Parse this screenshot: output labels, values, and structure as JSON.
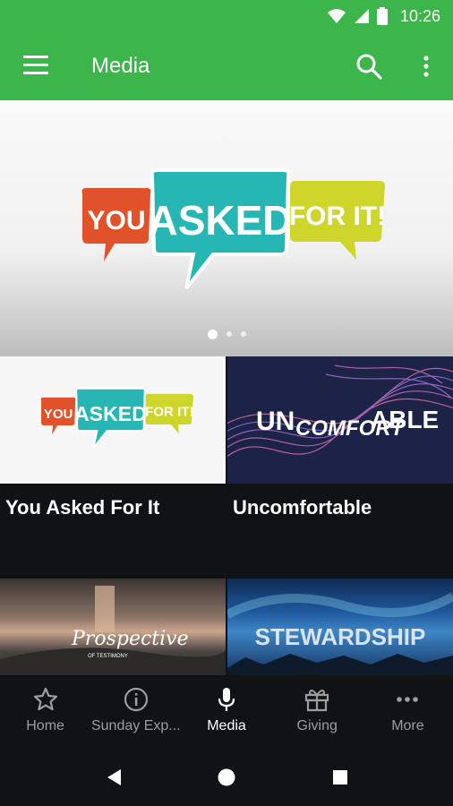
{
  "status_bar": {
    "time": "10:26"
  },
  "app_bar": {
    "title": "Media"
  },
  "hero": {
    "art_words": [
      "YOU",
      "ASKED",
      "FOR IT!"
    ],
    "colors": {
      "you": "#e2522a",
      "asked": "#26b7b5",
      "forit": "#cfd62b"
    },
    "slides": 3,
    "active_slide": 1
  },
  "cards": [
    {
      "title": "You Asked For It",
      "art_words": [
        "YOU",
        "ASKED",
        "FOR IT!"
      ]
    },
    {
      "title": "Uncomfortable",
      "art_words": [
        "UN",
        "COMFORT",
        "ABLE"
      ]
    },
    {
      "title": "",
      "art_words": [
        "Prospective",
        "OF TESTIMONY"
      ]
    },
    {
      "title": "",
      "art_words": [
        "STEWARDSHIP"
      ]
    }
  ],
  "bottom_nav": [
    {
      "label": "Home",
      "icon": "star-icon"
    },
    {
      "label": "Sunday Exp...",
      "icon": "info-icon"
    },
    {
      "label": "Media",
      "icon": "microphone-icon",
      "active": true
    },
    {
      "label": "Giving",
      "icon": "gift-icon"
    },
    {
      "label": "More",
      "icon": "more-horizontal-icon"
    }
  ],
  "colors": {
    "primary": "#3cb54a",
    "background": "#111213",
    "inactive": "#9e9e9e"
  }
}
